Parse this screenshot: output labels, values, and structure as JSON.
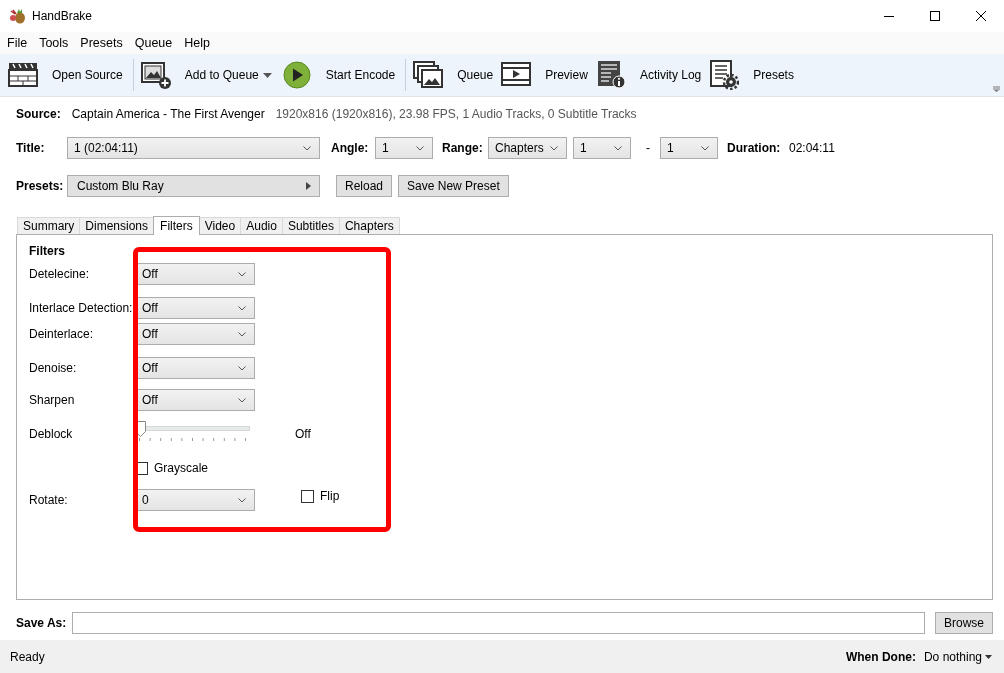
{
  "window": {
    "title": "HandBrake"
  },
  "menu": [
    "File",
    "Tools",
    "Presets",
    "Queue",
    "Help"
  ],
  "toolbar": [
    {
      "kind": "clapper",
      "label": "Open Source",
      "dropdown": false,
      "separator_after": true
    },
    {
      "kind": "add-picture",
      "label": "Add to Queue",
      "dropdown": true,
      "separator_after": false
    },
    {
      "kind": "play",
      "label": "Start Encode",
      "dropdown": false,
      "separator_after": true
    },
    {
      "kind": "pictures",
      "label": "Queue",
      "dropdown": false,
      "separator_after": false
    },
    {
      "kind": "film",
      "label": "Preview",
      "dropdown": false,
      "separator_after": false
    },
    {
      "kind": "log",
      "label": "Activity Log",
      "dropdown": false,
      "separator_after": false
    },
    {
      "kind": "doc-gear",
      "label": "Presets",
      "dropdown": false,
      "separator_after": false
    }
  ],
  "source": {
    "label": "Source:",
    "name": "Captain America - The First Avenger",
    "info": "1920x816 (1920x816), 23.98 FPS, 1 Audio Tracks, 0 Subtitle Tracks"
  },
  "title_row": {
    "title_label": "Title:",
    "title_value": "1 (02:04:11)",
    "angle_label": "Angle:",
    "angle_value": "1",
    "range_label": "Range:",
    "range_mode": "Chapters",
    "range_start": "1",
    "range_separator": "-",
    "range_end": "1",
    "duration_label": "Duration:",
    "duration": "02:04:11"
  },
  "presets": {
    "label": "Presets:",
    "value": "Custom Blu Ray",
    "buttons": [
      "Reload",
      "Save New Preset"
    ]
  },
  "tabs": [
    {
      "label": "Summary",
      "selected": false
    },
    {
      "label": "Dimensions",
      "selected": false
    },
    {
      "label": "Filters",
      "selected": true
    },
    {
      "label": "Video",
      "selected": false
    },
    {
      "label": "Audio",
      "selected": false
    },
    {
      "label": "Subtitles",
      "selected": false
    },
    {
      "label": "Chapters",
      "selected": false
    }
  ],
  "filters": {
    "heading": "Filters",
    "rows": [
      {
        "kind": "dropdown",
        "label": "Detelecine:",
        "value": "Off"
      },
      {
        "kind": "dropdown",
        "label": "Interlace Detection:",
        "value": "Off"
      },
      {
        "kind": "dropdown",
        "label": "Deinterlace:",
        "value": "Off"
      },
      {
        "kind": "dropdown",
        "label": "Denoise:",
        "value": "Off"
      },
      {
        "kind": "dropdown",
        "label": "Sharpen",
        "value": "Off"
      },
      {
        "kind": "slider",
        "label": "Deblock",
        "level": 0,
        "reading": "Off"
      },
      {
        "kind": "checkbox",
        "label": "Grayscale",
        "checked": false
      },
      {
        "kind": "dropdown",
        "label": "Rotate:",
        "value": "0",
        "flip": {
          "label": "Flip",
          "checked": false
        }
      }
    ]
  },
  "save_as": {
    "label": "Save As:",
    "button": "Browse"
  },
  "status_bar": {
    "status": "Ready",
    "when_done_label": "When Done:",
    "when_done": "Do nothing"
  }
}
